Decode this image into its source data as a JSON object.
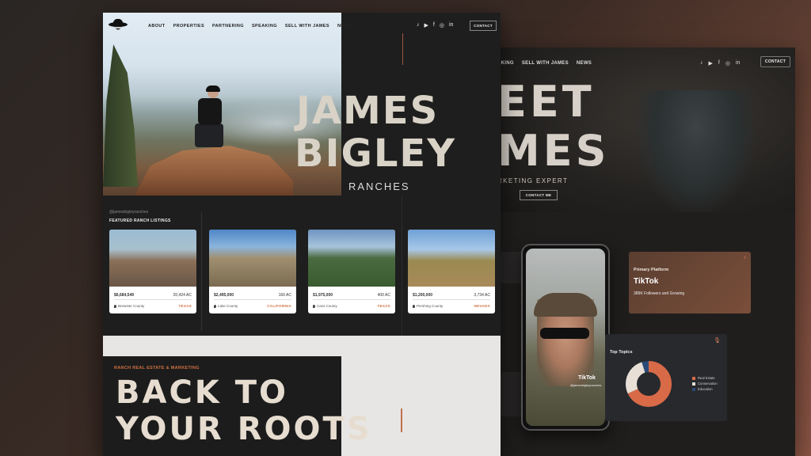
{
  "front": {
    "nav": {
      "links": [
        "ABOUT",
        "PROPERTIES",
        "PARTNERING",
        "SPEAKING",
        "SELL WITH JAMES",
        "NEWS"
      ],
      "contact": "CONTACT",
      "social_icons": [
        "tiktok-icon",
        "youtube-icon",
        "facebook-icon",
        "instagram-icon",
        "linkedin-icon"
      ]
    },
    "brand": {
      "line1": "JAMES",
      "line2": "BIGLEY",
      "sub": "RANCHES"
    },
    "handle": "@jamesbigleyranches",
    "listings_title": "FEATURED RANCH LISTINGS",
    "listings": [
      {
        "price": "$6,684,549",
        "acres": "20,424 AC",
        "county": "Brewster County",
        "state": "TEXAS",
        "img": "linear-gradient(180deg,#9bbcd4 0%,#a8c0cc 35%,#8a6f58 55%,#6a5648 100%)"
      },
      {
        "price": "$2,495,000",
        "acres": "160 AC",
        "county": "Lake County",
        "state": "CALIFORNIA",
        "img": "linear-gradient(180deg,#4f86c6 0%,#8ab4dc 30%,#a09070 50%,#7a6a50 100%)"
      },
      {
        "price": "$1,975,000",
        "acres": "400 AC",
        "county": "Cass County",
        "state": "TEXAS",
        "img": "linear-gradient(180deg,#6e94c0 0%,#a8c4dc 30%,#4a6a40 50%,#3a5a30 100%)"
      },
      {
        "price": "$1,200,000",
        "acres": "3,734 AC",
        "county": "Pershing County",
        "state": "NEVADA",
        "img": "linear-gradient(180deg,#6fa0d6 0%,#a8c8e8 35%,#9a8a50 55%,#a88a5a 100%)"
      }
    ],
    "lower": {
      "tag": "RANCH REAL ESTATE & MARKETING",
      "line1": "BACK TO",
      "line2": "YOUR ROOTS"
    }
  },
  "back": {
    "nav": {
      "links": [
        "AKING",
        "SELL WITH JAMES",
        "NEWS"
      ],
      "contact": "CONTACT",
      "social_icons": [
        "tiktok-icon",
        "youtube-icon",
        "facebook-icon",
        "instagram-icon",
        "linkedin-icon"
      ]
    },
    "hero": {
      "line1": "EET",
      "line2": "MES",
      "sub": "RKETING EXPERT",
      "cta": "CONTACT ME"
    },
    "phone": {
      "app_label": "TikTok",
      "handle": "@jamesbigleyranches"
    },
    "tiktok_card": {
      "label": "Primary Platform",
      "name": "TikTok",
      "followers": "389K Followers and Growing"
    },
    "topics": {
      "title": "Top Topics",
      "items": [
        {
          "name": "Real Estate",
          "color": "#d86a48"
        },
        {
          "name": "Conservation",
          "color": "#e8e0d6"
        },
        {
          "name": "Education",
          "color": "#2a4a78"
        }
      ]
    }
  },
  "chart_data": {
    "type": "pie",
    "categories": [
      "Real Estate",
      "Conservation",
      "Education"
    ],
    "values": [
      68,
      27,
      5
    ],
    "title": "Top Topics"
  }
}
